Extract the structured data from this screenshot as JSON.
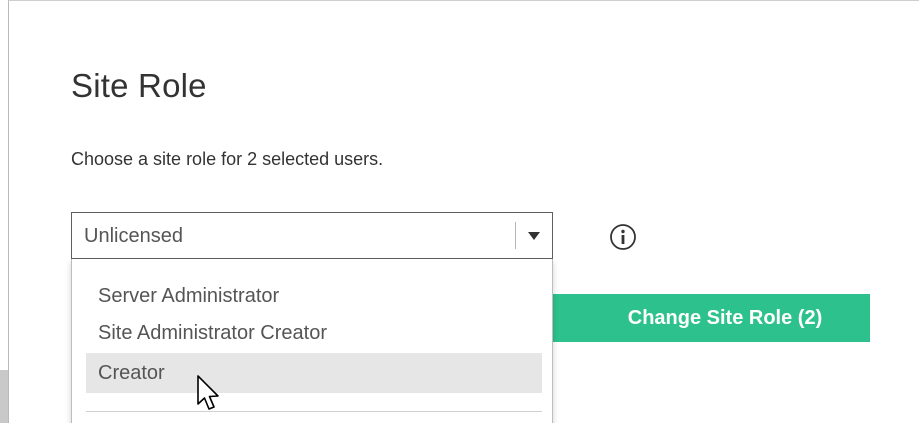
{
  "dialog": {
    "title": "Site Role",
    "subtitle": "Choose a site role for 2 selected users."
  },
  "role_select": {
    "selected_value": "Unlicensed",
    "options": [
      "Server Administrator",
      "Site Administrator Creator",
      "Creator"
    ],
    "hovered_option": "Creator"
  },
  "actions": {
    "change_role_label": "Change Site Role (2)"
  },
  "icons": {
    "info": "info-circle-icon",
    "caret": "caret-down-icon",
    "cursor": "mouse-pointer-icon"
  },
  "colors": {
    "primary_button": "#2dc28d",
    "hover_row": "#e6e6e6",
    "text": "#333333"
  }
}
